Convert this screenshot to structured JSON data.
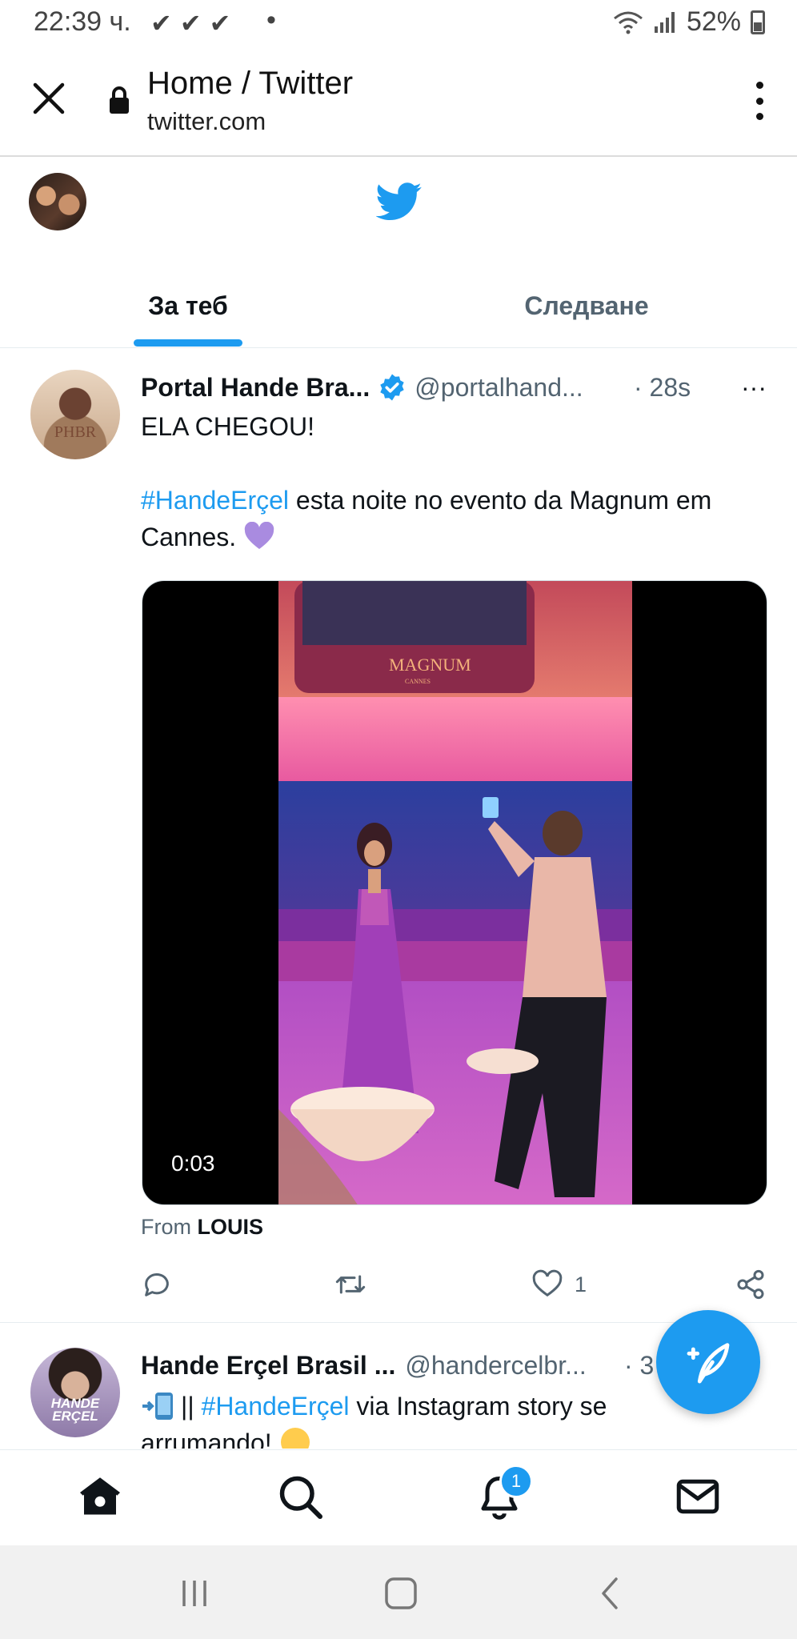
{
  "status_bar": {
    "time": "22:39 ч.",
    "checks": "✔✔✔",
    "dot": "•",
    "battery": "52%"
  },
  "browser": {
    "title": "Home / Twitter",
    "url": "twitter.com",
    "close_icon": "close-icon",
    "lock_icon": "lock-icon",
    "menu_icon": "more-vert-icon"
  },
  "tabs": [
    {
      "label": "За теб",
      "active": true
    },
    {
      "label": "Следване",
      "active": false
    }
  ],
  "tweets": [
    {
      "name": "Portal Hande Bra...",
      "handle": "@portalhand...",
      "time": "· 28s",
      "avatar_text": "PHBR",
      "line1": "ELA CHEGOU!",
      "hashtag": "#HandeErçel",
      "line2": " esta noite no evento da Magnum em Cannes.",
      "video_duration": "0:03",
      "video_sign": "MAGNUM",
      "video_sign_sub": "CANNES",
      "from_prefix": "From ",
      "from_name": "LOUIS",
      "likes": "1",
      "more": "···"
    },
    {
      "name": "Hande Erçel Brasil ...",
      "handle": "@handercelbr...",
      "time": "· 3",
      "avatar_text": "HANDE ERÇEL",
      "prefix": "||",
      "hashtag": "#HandeErçel",
      "text": " via Instagram story se",
      "line2": "arrumando!"
    }
  ],
  "notifications_badge": "1",
  "colors": {
    "accent": "#1d9bf0",
    "text": "#0f1419",
    "muted": "#536471"
  }
}
